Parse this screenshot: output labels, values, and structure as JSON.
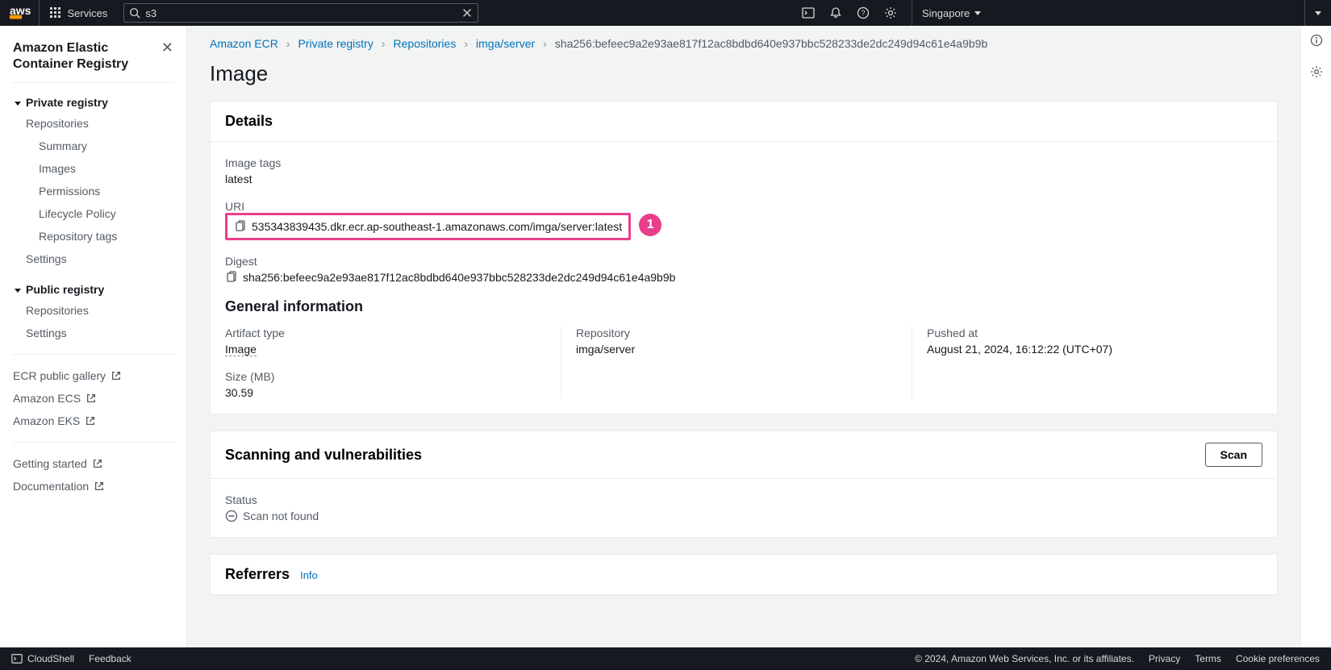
{
  "topnav": {
    "services_label": "Services",
    "search_value": "s3",
    "region": "Singapore"
  },
  "sidebar": {
    "title": "Amazon Elastic Container Registry",
    "private_header": "Private registry",
    "private_items": {
      "repositories": "Repositories",
      "summary": "Summary",
      "images": "Images",
      "permissions": "Permissions",
      "lifecycle": "Lifecycle Policy",
      "repotags": "Repository tags",
      "settings": "Settings"
    },
    "public_header": "Public registry",
    "public_items": {
      "repositories": "Repositories",
      "settings": "Settings"
    },
    "ext": {
      "gallery": "ECR public gallery",
      "ecs": "Amazon ECS",
      "eks": "Amazon EKS"
    },
    "help": {
      "getting_started": "Getting started",
      "documentation": "Documentation"
    }
  },
  "breadcrumbs": {
    "b1": "Amazon ECR",
    "b2": "Private registry",
    "b3": "Repositories",
    "b4": "imga/server",
    "current": "sha256:befeec9a2e93ae817f12ac8bdbd640e937bbc528233de2dc249d94c61e4a9b9b"
  },
  "page": {
    "title": "Image"
  },
  "details": {
    "heading": "Details",
    "tags_label": "Image tags",
    "tags_value": "latest",
    "uri_label": "URI",
    "uri_value": "535343839435.dkr.ecr.ap-southeast-1.amazonaws.com/imga/server:latest",
    "digest_label": "Digest",
    "digest_value": "sha256:befeec9a2e93ae817f12ac8bdbd640e937bbc528233de2dc249d94c61e4a9b9b",
    "gen_heading": "General information",
    "artifact_label": "Artifact type",
    "artifact_value": "Image",
    "repo_label": "Repository",
    "repo_value": "imga/server",
    "pushed_label": "Pushed at",
    "pushed_value": "August 21, 2024, 16:12:22 (UTC+07)",
    "size_label": "Size (MB)",
    "size_value": "30.59"
  },
  "scanning": {
    "heading": "Scanning and vulnerabilities",
    "scan_btn": "Scan",
    "status_label": "Status",
    "status_value": "Scan not found"
  },
  "referrers": {
    "heading": "Referrers",
    "info": "Info"
  },
  "footer": {
    "cloudshell": "CloudShell",
    "feedback": "Feedback",
    "copyright": "© 2024, Amazon Web Services, Inc. or its affiliates.",
    "privacy": "Privacy",
    "terms": "Terms",
    "cookies": "Cookie preferences"
  },
  "annotation": {
    "badge": "1"
  }
}
